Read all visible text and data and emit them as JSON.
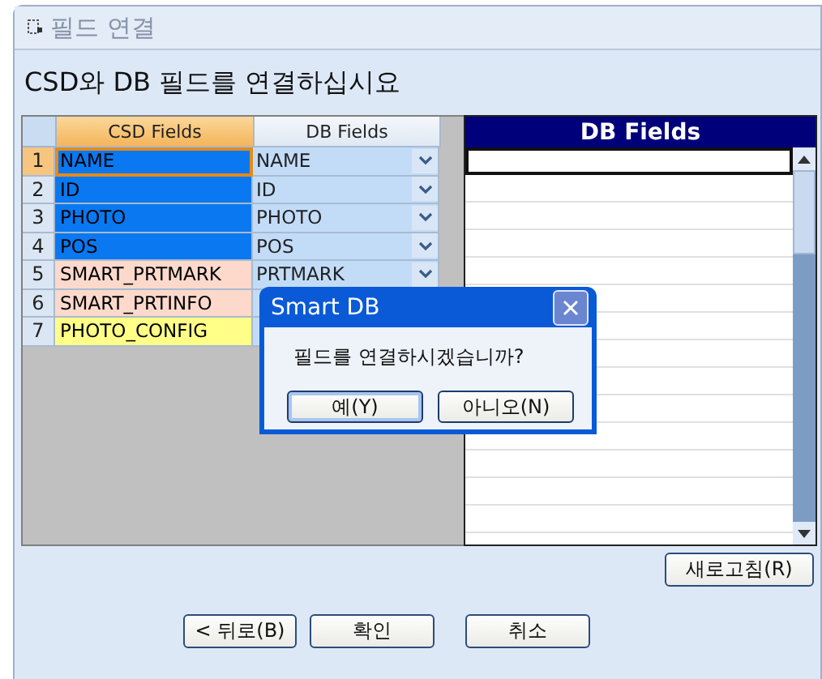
{
  "window": {
    "title": "필드 연결"
  },
  "heading": "CSD와 DB 필드를 연결하십시요",
  "grid": {
    "columns": [
      "CSD Fields",
      "DB Fields"
    ],
    "rows": [
      {
        "number": "1",
        "csd": "NAME",
        "db": "NAME",
        "color": "#0a78f0",
        "current": true
      },
      {
        "number": "2",
        "csd": "ID",
        "db": "ID",
        "color": "#0a78f0",
        "current": false
      },
      {
        "number": "3",
        "csd": "PHOTO",
        "db": "PHOTO",
        "color": "#0a78f0",
        "current": false
      },
      {
        "number": "4",
        "csd": "POS",
        "db": "POS",
        "color": "#0a78f0",
        "current": false
      },
      {
        "number": "5",
        "csd": "SMART_PRTMARK",
        "db": "PRTMARK",
        "color": "#fcd9cb",
        "current": false
      },
      {
        "number": "6",
        "csd": "SMART_PRTINFO",
        "color": "#fcd9cb",
        "current": false
      },
      {
        "number": "7",
        "csd": "PHOTO_CONFIG",
        "color": "#ffff88",
        "current": false
      }
    ]
  },
  "db_list": {
    "title": "DB Fields"
  },
  "refresh_button": "새로고침(R)",
  "buttons": [
    "< 뒤로(B)",
    "확인",
    "취소"
  ],
  "dialog": {
    "title": "Smart DB",
    "message": "필드를 연결하시겠습니까?",
    "buttons": [
      {
        "label": "예(Y)",
        "selected": true
      },
      {
        "label": "아니오(N)",
        "selected": false
      }
    ]
  }
}
